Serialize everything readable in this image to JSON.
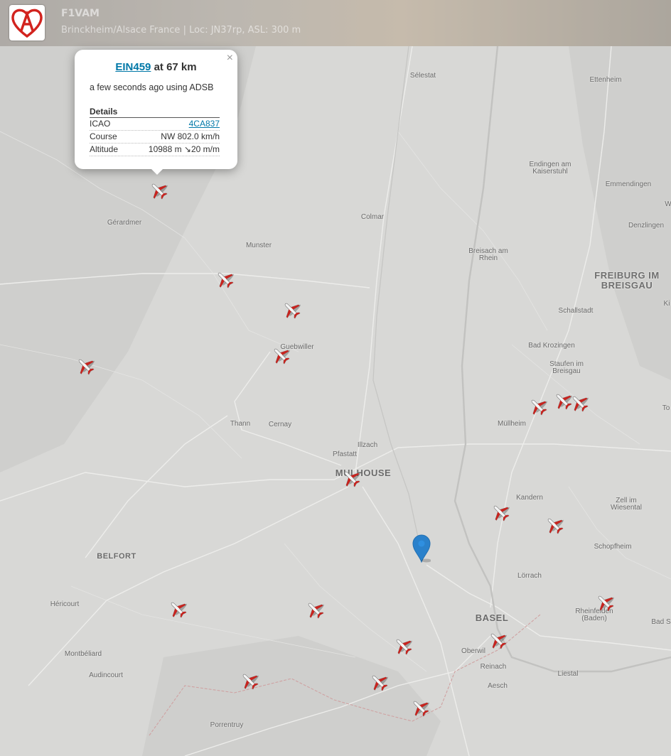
{
  "header": {
    "callsign": "F1VAM",
    "location_line": "Brinckheim/Alsace France | Loc: JN37rp, ASL: 300 m"
  },
  "popup": {
    "flight": "EIN459",
    "distance_text": " at 67 km",
    "last_seen": "a few seconds ago using ADSB",
    "details_heading": "Details",
    "close_glyph": "×",
    "rows": [
      {
        "label": "ICAO",
        "value": "4CA837"
      },
      {
        "label": "Course",
        "value": "NW 802.0 km/h"
      },
      {
        "label": "Altitude",
        "value": "10988 m ↘20 m/m"
      }
    ]
  },
  "places": [
    {
      "name": "Sélestat"
    },
    {
      "name": "Ettenheim"
    },
    {
      "name": "Gérardmer"
    },
    {
      "name": "Colmar"
    },
    {
      "name": "Endingen am Kaiserstuhl"
    },
    {
      "name": "Emmendingen"
    },
    {
      "name": "Denzlingen"
    },
    {
      "name": "Munster"
    },
    {
      "name": "Breisach am Rhein"
    },
    {
      "name": "FREIBURG IM BREISGAU"
    },
    {
      "name": "Schallstadt"
    },
    {
      "name": "Guebwiller"
    },
    {
      "name": "Bad Krozingen"
    },
    {
      "name": "Staufen im Breisgau"
    },
    {
      "name": "Thann"
    },
    {
      "name": "Cernay"
    },
    {
      "name": "Müllheim"
    },
    {
      "name": "Illzach"
    },
    {
      "name": "Pfastatt"
    },
    {
      "name": "MULHOUSE"
    },
    {
      "name": "Kandern"
    },
    {
      "name": "Zell im Wiesental"
    },
    {
      "name": "BELFORT"
    },
    {
      "name": "Schopfheim"
    },
    {
      "name": "Lörrach"
    },
    {
      "name": "Héricourt"
    },
    {
      "name": "BASEL"
    },
    {
      "name": "Rheinfelden (Baden)"
    },
    {
      "name": "Bad S"
    },
    {
      "name": "Oberwil"
    },
    {
      "name": "Montbéliard"
    },
    {
      "name": "Reinach"
    },
    {
      "name": "Liestal"
    },
    {
      "name": "Audincourt"
    },
    {
      "name": "Aesch"
    },
    {
      "name": "Porrentruy"
    },
    {
      "name": "To"
    },
    {
      "name": "Ki"
    },
    {
      "name": "W"
    }
  ],
  "aircraft_count": 22,
  "colors": {
    "link": "#0078a8",
    "marker": "#2a81cb",
    "plane_red": "#c8231e"
  },
  "icons": {
    "aircraft": "airplane-icon",
    "marker": "map-pin-icon",
    "logo": "heart-a-logo"
  }
}
